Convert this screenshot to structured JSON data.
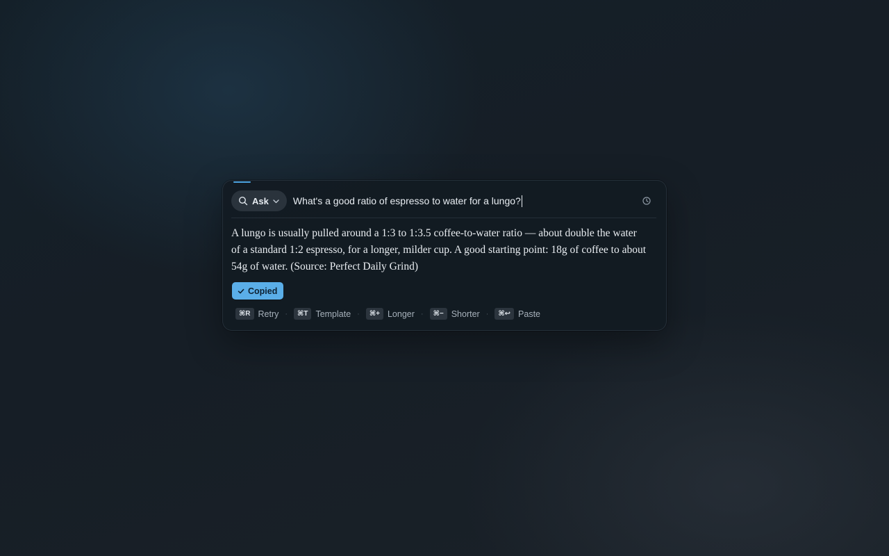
{
  "mode": {
    "label": "Ask",
    "icon": "search-icon",
    "dropdown_icon": "chevron-down-icon"
  },
  "query": {
    "value": "What's a good ratio of espresso to water for a lungo?"
  },
  "history": {
    "icon": "history-icon"
  },
  "answer": {
    "text": "A lungo is usually pulled around a 1:3 to 1:3.5 coffee-to-water ratio — about double the water of a standard 1:2 espresso, for a longer, milder cup. A good starting point: 18g of coffee to about 54g of water. (Source: Perfect Daily Grind)"
  },
  "status": {
    "copied_label": "Copied",
    "icon": "check-icon"
  },
  "actions": [
    {
      "key": "⌘R",
      "label": "Retry"
    },
    {
      "key": "⌘T",
      "label": "Template"
    },
    {
      "key": "⌘+",
      "label": "Longer"
    },
    {
      "key": "⌘−",
      "label": "Shorter"
    },
    {
      "key": "⌘↩",
      "label": "Paste"
    }
  ],
  "separator": "·",
  "colors": {
    "accent": "#5aaee8",
    "progress": "#4da3e0",
    "panel_bg": "#131b22",
    "text": "#e9edf1"
  }
}
